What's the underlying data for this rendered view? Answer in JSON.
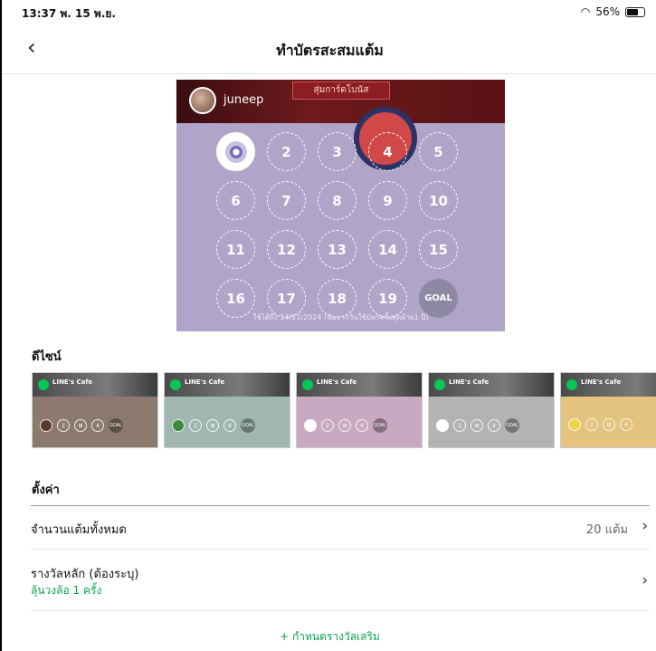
{
  "status_bar": {
    "time": "13:37",
    "date": "พ. 15 พ.ย.",
    "battery": "56%"
  },
  "header": {
    "title": "ทำบัตรสะสมแต้ม"
  },
  "card": {
    "username": "juneep",
    "bonus_badge": "สุ่มการ์ดโบนัส",
    "slots": [
      "",
      "2",
      "3",
      "4",
      "5",
      "6",
      "7",
      "8",
      "9",
      "10",
      "11",
      "12",
      "13",
      "14",
      "15",
      "16",
      "17",
      "18",
      "19",
      "GOAL"
    ],
    "validity": "ใช้ได้ถึง 14/11/2024 (นับจากวันใช้บัตรครั้งสุดท้าย1 ปี)"
  },
  "design_section": {
    "label": "ดีไซน์",
    "cards": [
      {
        "brand": "LINE's Cafe",
        "color": "#8c7a6e"
      },
      {
        "brand": "LINE's Cafe",
        "color": "#9fb7b0"
      },
      {
        "brand": "LINE's Cafe",
        "color": "#c9a9c2"
      },
      {
        "brand": "LINE's Cafe",
        "color": "#b3b3b3"
      },
      {
        "brand": "LINE's Cafe",
        "color": "#e3c37e"
      }
    ],
    "mini_slots": [
      "2",
      "⊞",
      "4",
      "GOAL"
    ]
  },
  "settings": {
    "label": "ตั้งค่า",
    "total_points_label": "จำนวนแต้มทั้งหมด",
    "total_points_value": "20 แต้ม",
    "main_reward_label": "รางวัลหลัก (ต้องระบุ)",
    "main_reward_value": "ลุ้นวงล้อ 1 ครั้ง",
    "add_bonus": "+ กำหนดรางวัลเสริม"
  },
  "colors": {
    "accent": "#06c755",
    "card_bg": "#b0a4c8"
  }
}
